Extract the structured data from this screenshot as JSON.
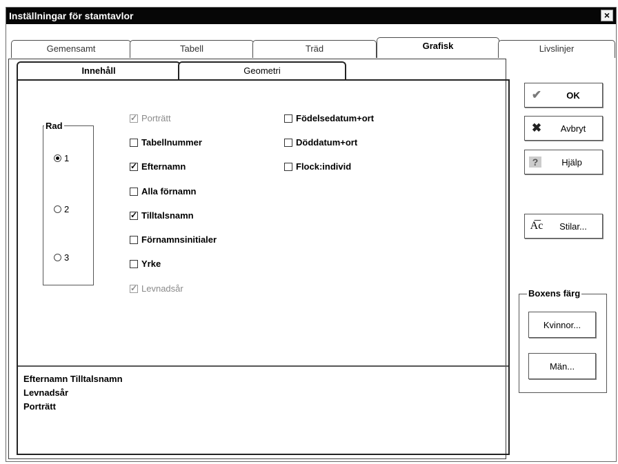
{
  "window": {
    "title": "Inställningar för stamtavlor",
    "close_glyph": "×"
  },
  "tabs": [
    {
      "label": "Gemensamt"
    },
    {
      "label": "Tabell"
    },
    {
      "label": "Träd"
    },
    {
      "label": "Grafisk"
    },
    {
      "label": "Livslinjer"
    }
  ],
  "subtabs": [
    {
      "label": "Innehåll"
    },
    {
      "label": "Geometri"
    }
  ],
  "rad": {
    "label": "Rad",
    "options": [
      "1",
      "2",
      "3"
    ],
    "selected": "1"
  },
  "checkboxes_col1": [
    {
      "label": "Porträtt",
      "checked": true,
      "disabled": true
    },
    {
      "label": "Tabellnummer",
      "checked": false,
      "disabled": false
    },
    {
      "label": "Efternamn",
      "checked": true,
      "disabled": false
    },
    {
      "label": "Alla förnamn",
      "checked": false,
      "disabled": false
    },
    {
      "label": "Tilltalsnamn",
      "checked": true,
      "disabled": false
    },
    {
      "label": "Förnamnsinitialer",
      "checked": false,
      "disabled": false
    },
    {
      "label": "Yrke",
      "checked": false,
      "disabled": false
    },
    {
      "label": "Levnadsår",
      "checked": true,
      "disabled": true
    }
  ],
  "checkboxes_col2": [
    {
      "label": "Födelsedatum+ort",
      "checked": false
    },
    {
      "label": "Döddatum+ort",
      "checked": false
    },
    {
      "label": "Flock:individ",
      "checked": false
    }
  ],
  "preview": {
    "lines": [
      "Efternamn Tilltalsnamn",
      "Levnadsår",
      "Porträtt"
    ]
  },
  "buttons": {
    "ok": "OK",
    "cancel": "Avbryt",
    "help": "Hjälp",
    "styles": "Stilar...",
    "women": "Kvinnor...",
    "men": "Män..."
  },
  "box_color_group": {
    "label": "Boxens färg"
  },
  "colors": {
    "ok_icon": "#7a7a7a",
    "cancel_icon": "#333333",
    "help_icon": "#8a8a8a"
  }
}
